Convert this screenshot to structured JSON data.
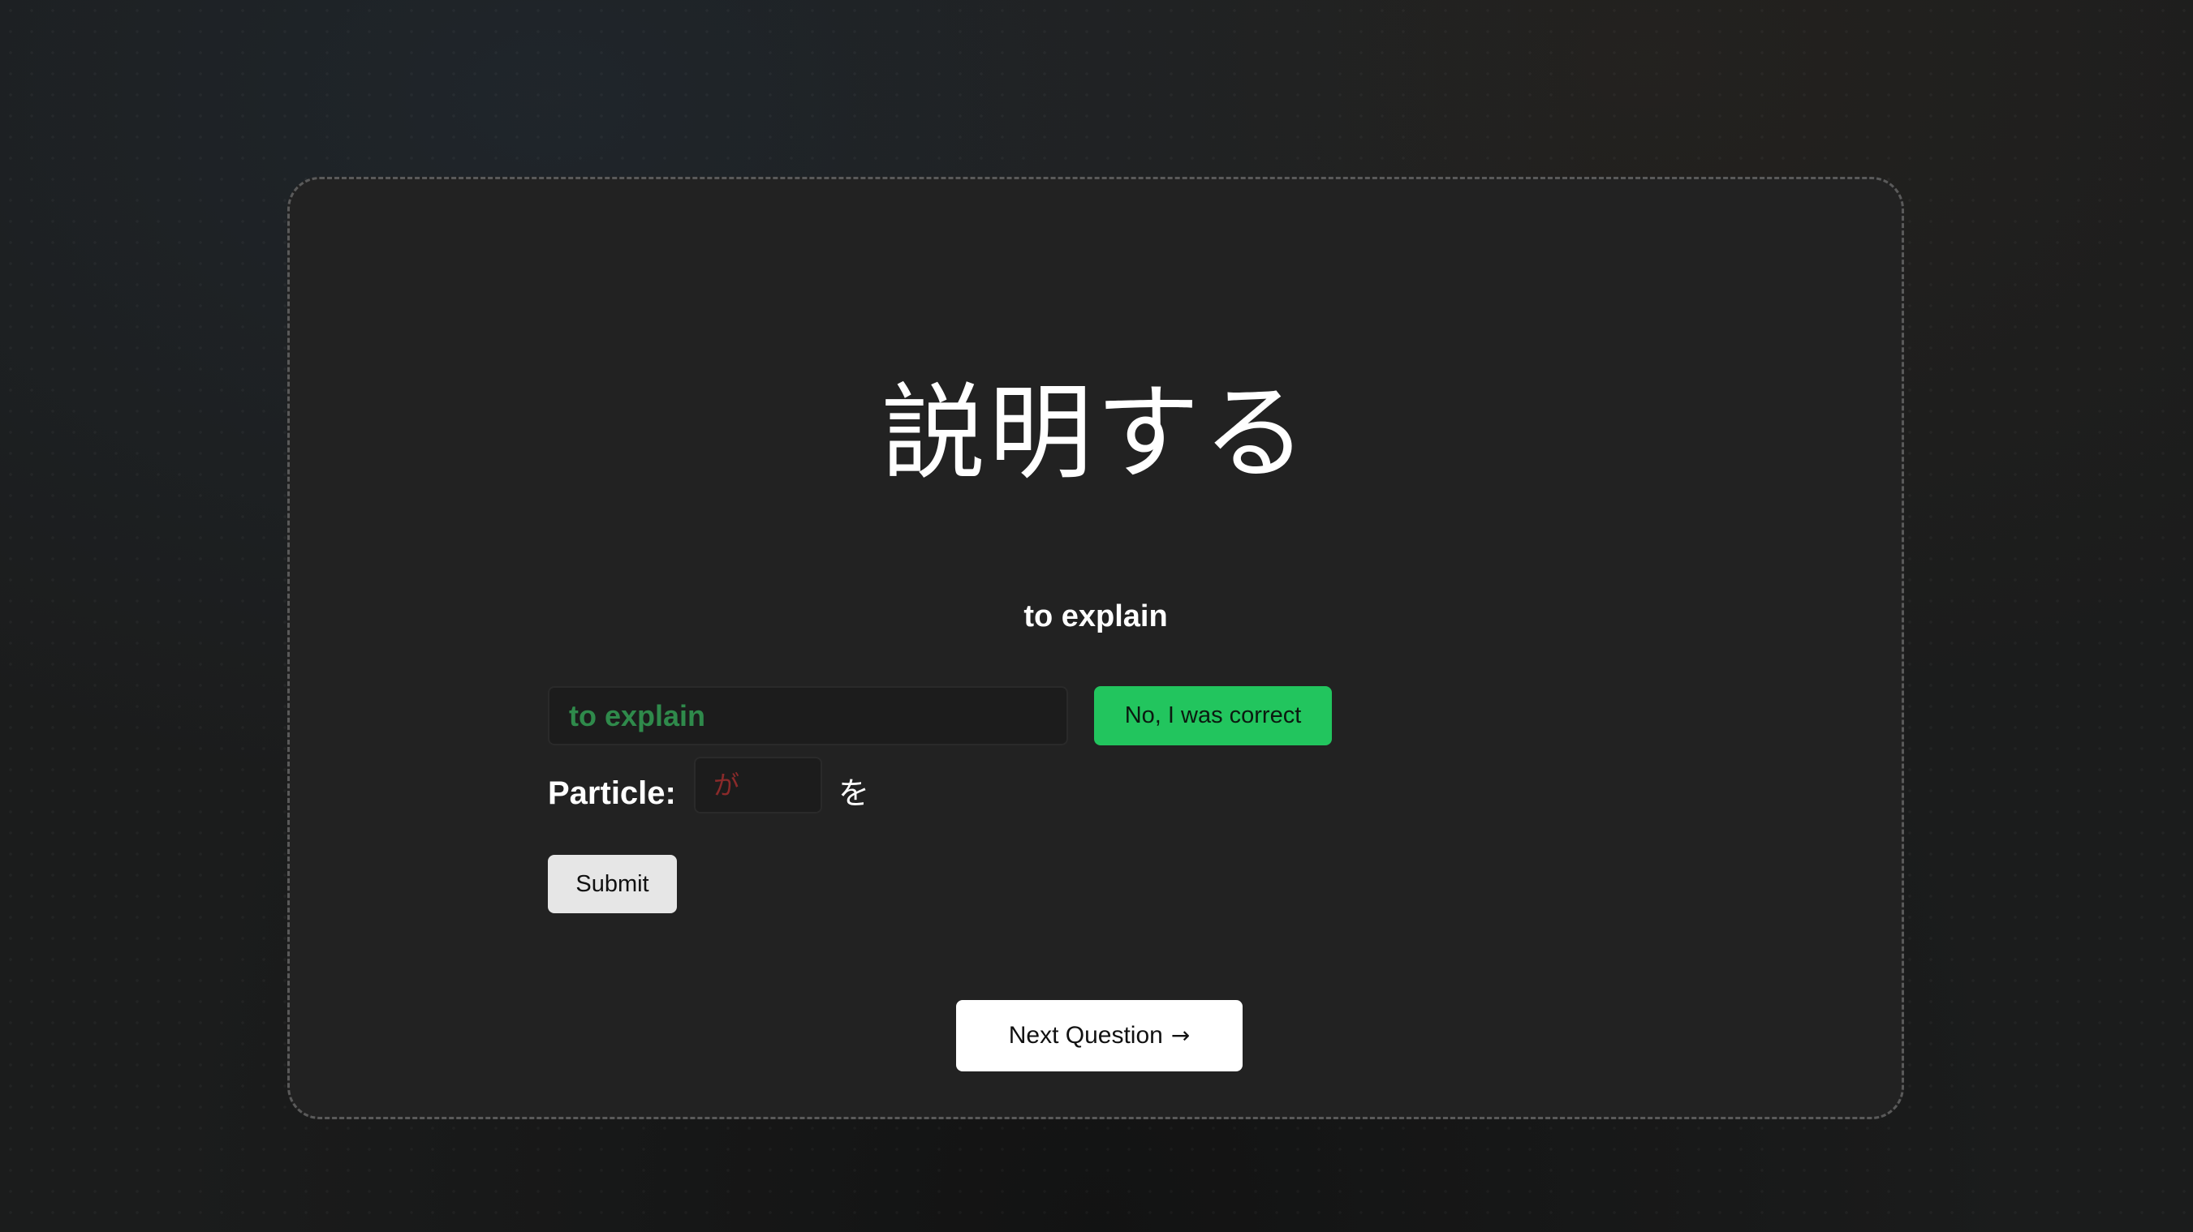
{
  "quiz": {
    "word": "説明する",
    "meaning": "to explain",
    "answer_value": "to explain",
    "override_label": "No, I was correct",
    "particle_label": "Particle:",
    "particle_value": "が",
    "correct_particle": "を",
    "submit_label": "Submit",
    "next_label": "Next Question",
    "next_icon": "arrow-right-icon"
  },
  "colors": {
    "correct_text": "#2f8a4b",
    "incorrect_text": "#8a2a2a",
    "override_button": "#22c55e",
    "card_background": "#222222"
  }
}
